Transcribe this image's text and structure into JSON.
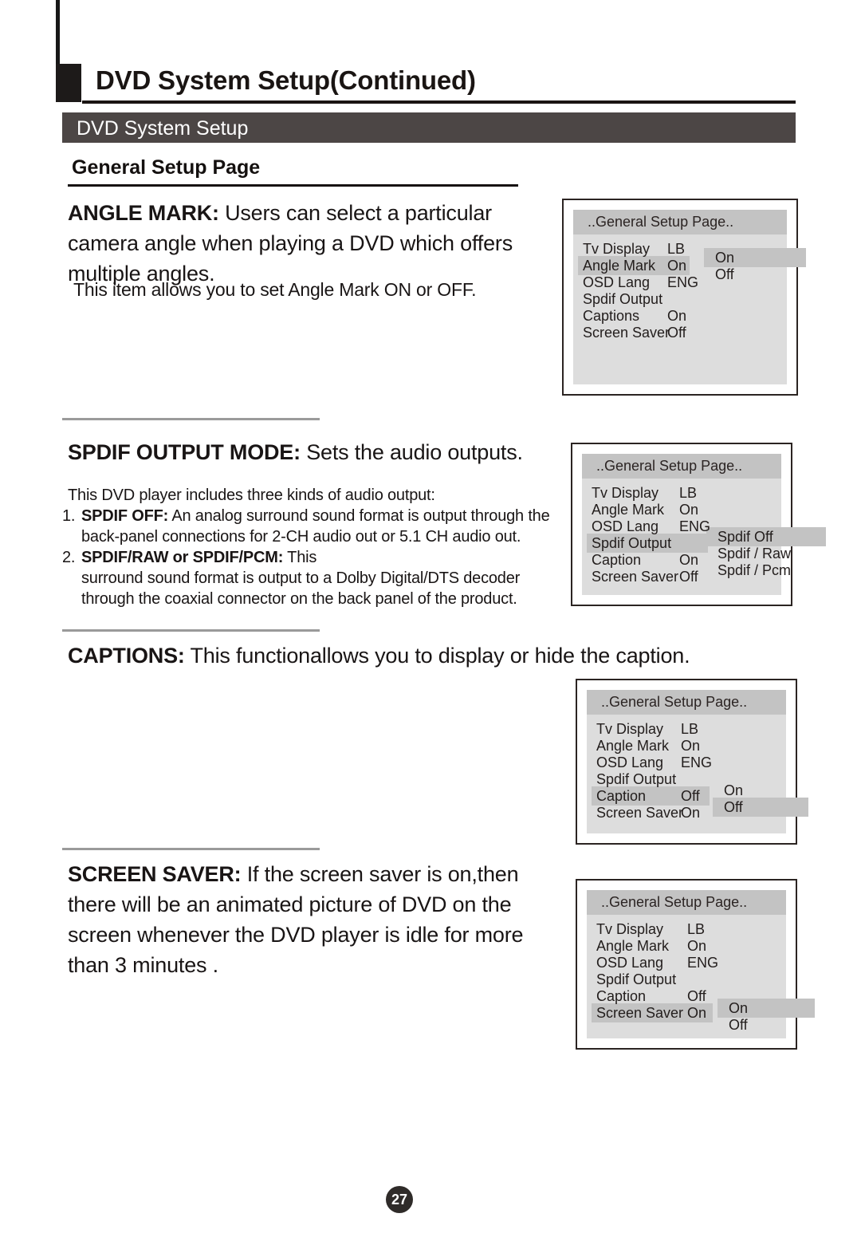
{
  "header": {
    "title": "DVD System Setup(Continued)",
    "band_label": "DVD System Setup",
    "section_heading": "General Setup Page"
  },
  "sections": {
    "angle_mark": {
      "lead_bold": "ANGLE MARK:",
      "lead_rest": " Users can select a particular camera angle when playing  a DVD which offers multiple angles.",
      "sub": "This item allows you to set Angle Mark ON or OFF."
    },
    "spdif": {
      "lead_bold": "SPDIF OUTPUT MODE:",
      "lead_rest": " Sets the audio outputs.",
      "intro": "This DVD player  includes three kinds  of audio output:",
      "item1_num": "1.",
      "item1_bold": "SPDIF OFF:",
      "item1_rest": "  An analog surround sound format  is output through the back-panel connections for  2-CH audio out or 5.1 CH  audio out.",
      "item2_num": "2.",
      "item2_bold": "SPDIF/RAW or SPDIF/PCM:",
      "item2_rest": " This",
      "item2_cont": "surround sound  format  is  output to a Dolby  Digital/DTS decoder through the coaxial  connector on the  back panel of  the product."
    },
    "captions": {
      "lead_bold": "CAPTIONS:",
      "lead_rest": " This functionallows you to display or hide the caption."
    },
    "screen_saver": {
      "lead_bold": "SCREEN SAVER:",
      "lead_rest": " If the screen saver is on,then  there will be an animated picture of DVD  on the screen whenever the DVD player is idle for  more than 3 minutes ."
    }
  },
  "osd_panels": [
    {
      "title": "..General Setup Page..",
      "rows": [
        {
          "label": "Tv Display",
          "value": "LB",
          "highlighted": false
        },
        {
          "label": "Angle Mark",
          "value": "On",
          "highlighted": true
        },
        {
          "label": "OSD Lang",
          "value": "ENG",
          "highlighted": false
        },
        {
          "label": "Spdif Output",
          "value": "",
          "highlighted": false
        },
        {
          "label": "Captions",
          "value": "On",
          "highlighted": false
        },
        {
          "label": "Screen Saver",
          "value": "Off",
          "highlighted": false
        }
      ],
      "submenu": [
        {
          "label": "On",
          "selected": true
        },
        {
          "label": "Off",
          "selected": false
        }
      ]
    },
    {
      "title": "..General Setup Page..",
      "rows": [
        {
          "label": "Tv Display",
          "value": "LB",
          "highlighted": false
        },
        {
          "label": "Angle Mark",
          "value": "On",
          "highlighted": false
        },
        {
          "label": "OSD Lang",
          "value": "ENG",
          "highlighted": false
        },
        {
          "label": "Spdif Output",
          "value": "",
          "highlighted": true
        },
        {
          "label": "Caption",
          "value": "On",
          "highlighted": false
        },
        {
          "label": "Screen Saver",
          "value": "Off",
          "highlighted": false
        }
      ],
      "submenu": [
        {
          "label": "Spdif Off",
          "selected": true
        },
        {
          "label": "Spdif / Raw",
          "selected": false
        },
        {
          "label": "Spdif / Pcm",
          "selected": false
        }
      ]
    },
    {
      "title": "..General Setup Page..",
      "rows": [
        {
          "label": "Tv Display",
          "value": "LB",
          "highlighted": false
        },
        {
          "label": "Angle Mark",
          "value": "On",
          "highlighted": false
        },
        {
          "label": "OSD Lang",
          "value": "ENG",
          "highlighted": false
        },
        {
          "label": "Spdif Output",
          "value": "",
          "highlighted": false
        },
        {
          "label": "Caption",
          "value": "Off",
          "highlighted": true
        },
        {
          "label": "Screen Saver",
          "value": "On",
          "highlighted": false
        }
      ],
      "submenu": [
        {
          "label": "On",
          "selected": false
        },
        {
          "label": "Off",
          "selected": true
        }
      ]
    },
    {
      "title": "..General Setup Page..",
      "rows": [
        {
          "label": "Tv Display",
          "value": "LB",
          "highlighted": false
        },
        {
          "label": "Angle Mark",
          "value": "On",
          "highlighted": false
        },
        {
          "label": "OSD Lang",
          "value": "ENG",
          "highlighted": false
        },
        {
          "label": "Spdif Output",
          "value": "",
          "highlighted": false
        },
        {
          "label": "Caption",
          "value": "Off",
          "highlighted": false
        },
        {
          "label": "Screen Saver",
          "value": "On",
          "highlighted": true
        }
      ],
      "submenu": [
        {
          "label": "On",
          "selected": true
        },
        {
          "label": "Off",
          "selected": false
        }
      ]
    }
  ],
  "footer": {
    "page_number": "27"
  },
  "colors": {
    "band": "#4c4645",
    "osd_bg": "#dddddd",
    "osd_highlight": "#c3c3c3",
    "ink": "#1a1513"
  }
}
